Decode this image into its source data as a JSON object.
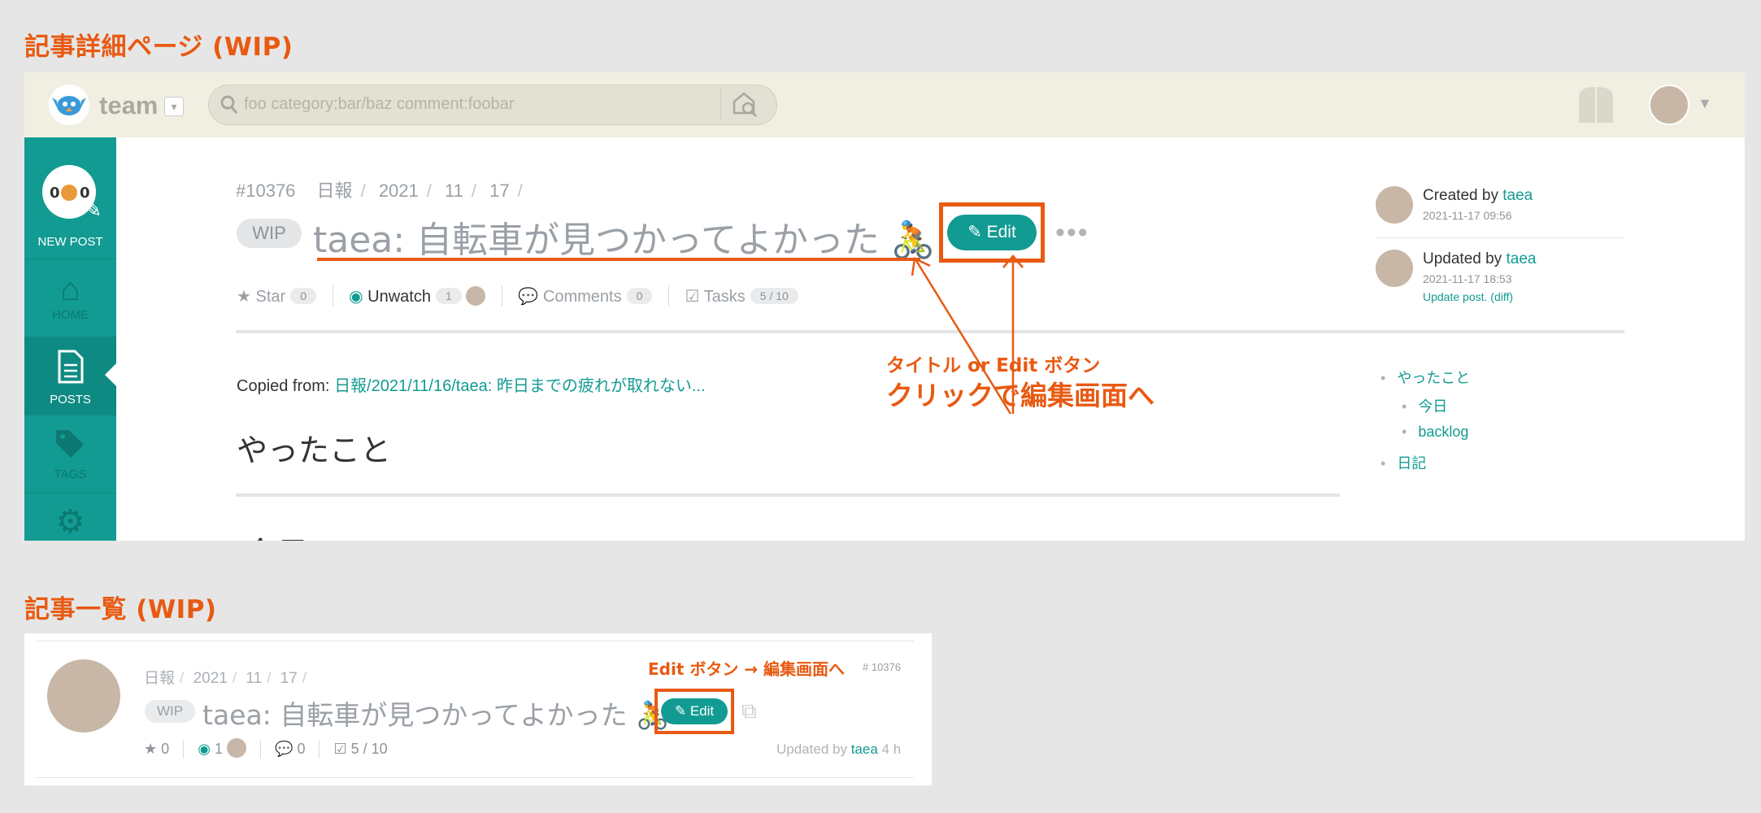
{
  "sections": {
    "detail_title": "記事詳細ページ (WIP)",
    "list_title": "記事一覧 (WIP)"
  },
  "header": {
    "team_name": "team",
    "search_placeholder": "foo category:bar/baz comment:foobar"
  },
  "sidebar": {
    "new_post": "NEW POST",
    "home": "HOME",
    "posts": "POSTS",
    "tags": "TAGS"
  },
  "post": {
    "number": "#10376",
    "breadcrumbs": [
      "日報",
      "2021",
      "11",
      "17"
    ],
    "wip_label": "WIP",
    "title": "taea: 自転車が見つかってよかった 🚴",
    "edit_label": "Edit",
    "star_label": "Star",
    "star_count": "0",
    "watch_label": "Unwatch",
    "watch_count": "1",
    "comments_label": "Comments",
    "comments_count": "0",
    "tasks_label": "Tasks",
    "tasks_count": "5 / 10",
    "copied_prefix": "Copied from:",
    "copied_link": "日報/2021/11/16/taea: 昨日までの疲れが取れない...",
    "heading": "やったこと",
    "cut_text": "今日"
  },
  "meta": {
    "created_prefix": "Created by",
    "created_user": "taea",
    "created_date": "2021-11-17 09:56",
    "updated_prefix": "Updated by",
    "updated_user": "taea",
    "updated_date": "2021-11-17 18:53",
    "update_note": "Update post. (diff)"
  },
  "toc": [
    "やったこと",
    "今日",
    "backlog",
    "日記"
  ],
  "annotations": {
    "detail_small": "タイトル or Edit ボタン",
    "detail_big": "クリックで編集画面へ",
    "list_note": "Edit ボタン → 編集画面へ"
  },
  "list_item": {
    "breadcrumbs": [
      "日報",
      "2021",
      "11",
      "17"
    ],
    "wip_label": "WIP",
    "title": "taea: 自転車が見つかってよかった 🚴",
    "edit_label": "Edit",
    "number": "# 10376",
    "star_count": "0",
    "watch_count": "1",
    "comments_count": "0",
    "tasks_count": "5 / 10",
    "updated_prefix": "Updated by",
    "updated_user": "taea",
    "updated_ago": "4 h"
  },
  "colors": {
    "accent": "#129b92",
    "annotation": "#e85a12"
  }
}
